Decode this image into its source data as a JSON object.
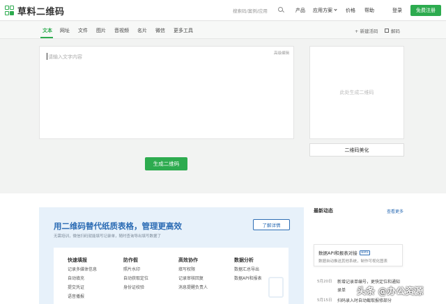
{
  "header": {
    "logo_text": "草料二维码",
    "search_placeholder": "搜索码/案例/应用",
    "nav": [
      "产品",
      "应用方案",
      "价格",
      "帮助",
      "登录"
    ],
    "register_label": "免费注册"
  },
  "tabs": {
    "items": [
      "文本",
      "网址",
      "文件",
      "图片",
      "音视频",
      "名片",
      "微信",
      "更多工具"
    ],
    "active": "文本",
    "new_live_code": "+ 新建活码",
    "decode": "解码"
  },
  "editor": {
    "placeholder": "请输入文字内容",
    "advanced_edit": "高级编辑",
    "generate_label": "生成二维码"
  },
  "preview": {
    "placeholder": "此处生成二维码",
    "beautify_label": "二维码美化"
  },
  "banner": {
    "title": "用二维码替代纸质表格，管理更高效",
    "subtitle": "无需培训，微信扫码就能填写记录单，随时查询导出填写数据了",
    "details_label": "了解详情",
    "columns": [
      {
        "title": "快速填报",
        "items": [
          "记录多媒体信息",
          "自动填充",
          "提交凭证",
          "语音播报"
        ]
      },
      {
        "title": "防作假",
        "items": [
          "照片水印",
          "自动获取定位",
          "身份证校验"
        ]
      },
      {
        "title": "高效协作",
        "items": [
          "填写权限",
          "记录审核回复",
          "消息提醒负责人"
        ]
      },
      {
        "title": "数据分析",
        "items": [
          "数据汇总导出",
          "数据API和报表"
        ]
      }
    ]
  },
  "news": {
    "title": "最新动态",
    "more_label": "查看更多",
    "featured_title": "数据API和报表对接",
    "featured_badge": "Beta",
    "featured_sub": "数据自动推送其他系统，制作可视化图表",
    "items": [
      {
        "date": "5月20日",
        "line1": "新增记录单编号，更快定位和通知",
        "line2": "录单"
      },
      {
        "date": "5月15日",
        "line1": "扫码录入时自动截取报修部分"
      }
    ]
  },
  "watermark": "头条 @办公资源",
  "colors": {
    "brand_green": "#2dab4f",
    "accent_blue": "#2c6cb4"
  }
}
